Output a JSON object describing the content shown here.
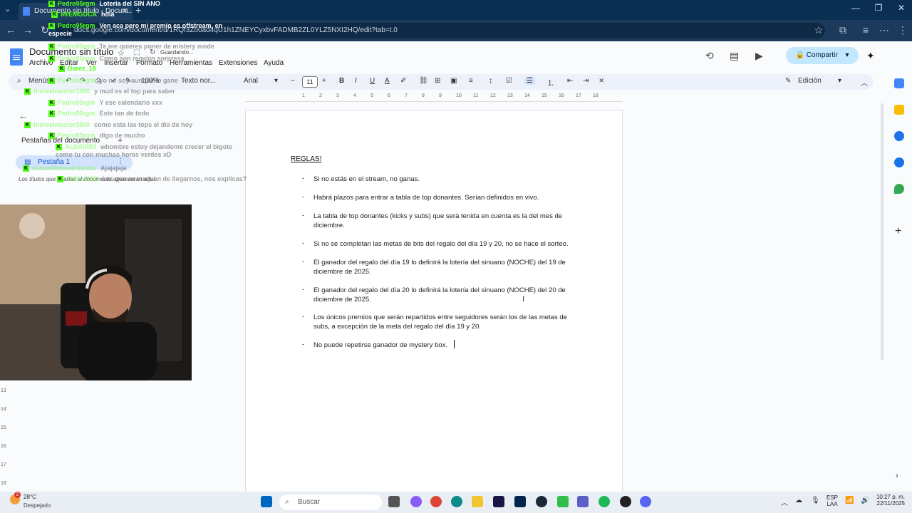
{
  "browser": {
    "tab_title": "Documento sin título - Docum...",
    "url": "docs.google.com/document/d/1RQf3Zo0ad4qU1h1ZNEYCyxbvFADMB2ZL0YLZ5NXI2HQ/edit?tab=t.0"
  },
  "docs": {
    "title": "Documento sin título",
    "saving_status": "Guardando...",
    "menu": [
      "Archivo",
      "Editar",
      "Ver",
      "Insertar",
      "Formato",
      "Herramientas",
      "Extensiones",
      "Ayuda"
    ],
    "share_label": "Compartir",
    "toolbar": {
      "menus": "Menús",
      "zoom": "100%",
      "style": "Texto nor...",
      "font": "Arial",
      "font_size": "11",
      "mode": "Edición"
    },
    "ruler_ticks": [
      "1",
      "2",
      "3",
      "4",
      "5",
      "6",
      "7",
      "8",
      "9",
      "10",
      "11",
      "12",
      "13",
      "14",
      "15",
      "16",
      "17",
      "18"
    ],
    "vruler_ticks": [
      "13",
      "14",
      "15",
      "16",
      "17",
      "18"
    ]
  },
  "left_panel": {
    "heading": "Pestañas del documento",
    "tab_label": "Pestaña 1",
    "hint": "Los títulos que añadas al documento aparecerán aquí."
  },
  "document": {
    "title": "REGLAS!",
    "rules": [
      "Si no estás en el stream, no ganas.",
      "Habrá plazos para entrar a tabla de top donantes. Serían definidos en vivo.",
      "La tabla de top donantes (kicks y subs) que será tenida en cuenta es la del mes de diciembre.",
      "Si no se completan las metas de bits del regalo del día 19 y 20, no se hace el sorteo.",
      "El ganador del regalo del día 19 lo definirá la lotería del sinuano (NOCHE) del 19 de diciembre de 2025.",
      "El ganador del regalo del día 20 lo definirá la lotería del sinuano (NOCHE) del 20 de diciembre de 2025.",
      "Los únicos premios que serán repartidos entre seguidores serán los de las metas de subs, a excepción de la meta del regalo del día 19 y 20.",
      "No puede repetirse ganador de mystery box."
    ],
    "dash": "-"
  },
  "chat": [
    {
      "user": "Pedro95rgm",
      "msg": "Loteria del SIN ANO",
      "faded": false
    },
    {
      "user": "MrEMGUCA",
      "msg": "hola",
      "faded": false
    },
    {
      "user": "Pedro95rgm",
      "msg": "Ven aca pero mi premio es offstream, en especie",
      "faded": false
    },
    {
      "user": "Pedro95rgm",
      "msg": "Te me quieres poner de mistery mode",
      "faded": true
    },
    {
      "user": "Pedro95rgm",
      "msg": "Como son regalos sorpresa",
      "faded": true
    },
    {
      "user": "Darez_18",
      "msg": "",
      "faded": false
    },
    {
      "user": "Pedro95rgm",
      "msg": "yo no soy aunque lo gane",
      "faded": true
    },
    {
      "user": "thereelmaster1590",
      "msg": "y mud es el top para saber",
      "faded": true
    },
    {
      "user": "Pedro95rgm",
      "msg": "Y ese calendario xxx",
      "faded": true
    },
    {
      "user": "Pedro95rgm",
      "msg": "Este tan de todo",
      "faded": true
    },
    {
      "user": "thereelmaster1590",
      "msg": "como esta las tops el dia de hoy",
      "faded": true
    },
    {
      "user": "Pedro95rgm",
      "msg": "digo de mucho",
      "faded": true
    },
    {
      "user": "ALDAIR93",
      "msg": "whombre estoy dejandome crecer el bigote como tu con muchas horas verdes xD",
      "faded": true
    },
    {
      "user": "samuelinhoelnininho",
      "msg": "Ajajajaja",
      "faded": true
    },
    {
      "user": "CHILLESS",
      "msg": "Las que se vuelvan de llegarnos, nos explicas?",
      "faded": true
    }
  ],
  "taskbar": {
    "weather_temp": "28°C",
    "weather_desc": "Despejado",
    "search": "Buscar",
    "lang": "ESP",
    "lang2": "LAA",
    "time": "10:27 p. m.",
    "date": "22/11/2025",
    "badge": "2"
  },
  "colors": {
    "kick_green": "#53fc18",
    "share_bg": "#c2e7ff",
    "title_bar": "#0b2f52"
  }
}
